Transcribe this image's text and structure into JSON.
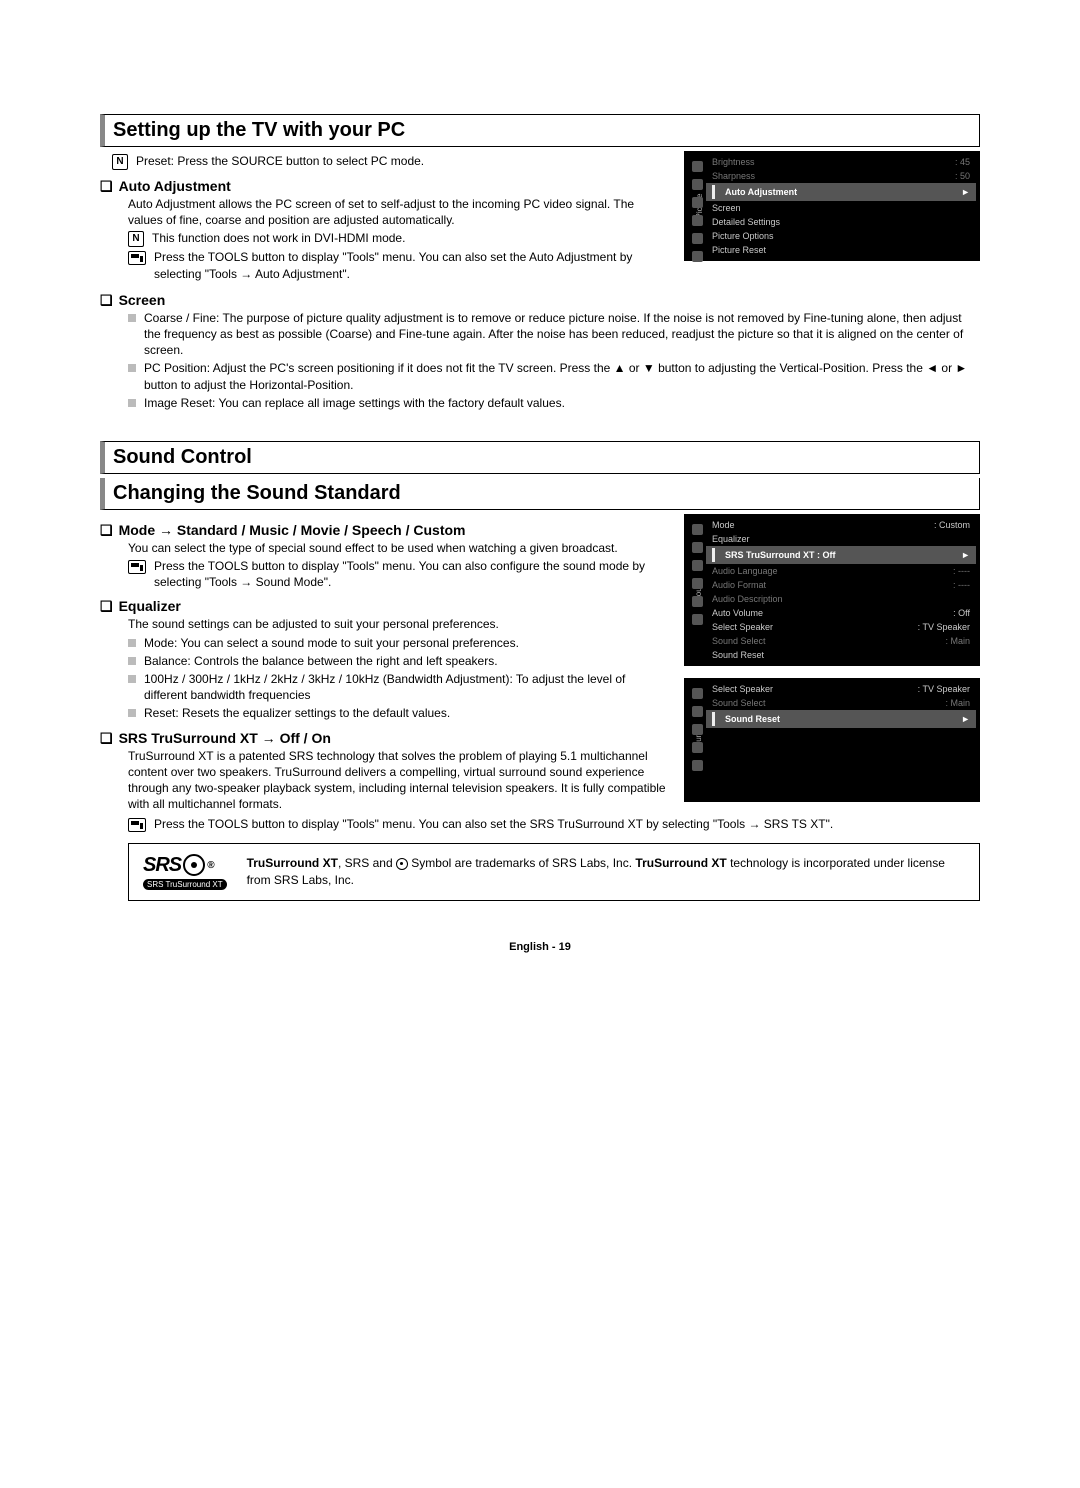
{
  "sections": {
    "pc": {
      "title": "Setting up the TV with your PC",
      "preset_note": "Preset: Press the SOURCE button to select PC mode.",
      "auto_adj": {
        "heading": "Auto Adjustment",
        "body": "Auto Adjustment allows the PC screen of set to self-adjust to the incoming PC video signal. The values of fine, coarse and position are adjusted automatically.",
        "note": "This function does not work in DVI-HDMI mode.",
        "tool": "Press the TOOLS button to display \"Tools\" menu. You can also set the Auto Adjustment by selecting \"Tools → Auto Adjustment\"."
      },
      "screen": {
        "heading": "Screen",
        "items": [
          "Coarse / Fine: The purpose of picture quality adjustment is to remove or reduce picture noise. If the noise is not removed by Fine-tuning alone, then adjust the frequency as best as possible (Coarse) and Fine-tune again. After the noise has been reduced, readjust the picture so that it is aligned on the center of screen.",
          "PC Position: Adjust the PC's screen positioning if it does not fit the TV screen. Press the ▲ or ▼ button to adjusting the Vertical-Position. Press the ◄ or ► button to adjust the Horizontal-Position.",
          "Image Reset: You can replace all image settings with the factory default values."
        ]
      }
    },
    "sound": {
      "title_major": "Sound Control",
      "title": "Changing the Sound Standard",
      "mode": {
        "heading": "Mode → Standard / Music / Movie / Speech / Custom",
        "body": "You can select the type of special sound effect to be used when watching a given broadcast.",
        "tool": "Press the TOOLS button to display \"Tools\" menu. You can also configure the sound mode by selecting \"Tools → Sound Mode\"."
      },
      "eq": {
        "heading": "Equalizer",
        "body": "The sound settings can be adjusted to suit your personal preferences.",
        "items": [
          "Mode: You can select a sound mode to suit your personal preferences.",
          "Balance: Controls the balance between the right and left speakers.",
          "100Hz / 300Hz / 1kHz / 2kHz / 3kHz / 10kHz (Bandwidth Adjustment): To adjust the level of different bandwidth frequencies",
          "Reset: Resets the equalizer settings to the default values."
        ]
      },
      "srs": {
        "heading": "SRS TruSurround XT → Off / On",
        "body": "TruSurround XT is a patented SRS technology that solves the problem of playing 5.1 multichannel content over two speakers. TruSurround delivers a compelling, virtual surround sound experience through any two-speaker playback system, including internal television speakers. It is fully compatible with all multichannel formats.",
        "tool": "Press the TOOLS button to display \"Tools\" menu. You can also set the SRS TruSurround XT by selecting \"Tools → SRS TS XT\"."
      },
      "srs_box": {
        "logo_text": "SRS",
        "logo_tag": "SRS TruSurround XT",
        "text_before": "TruSurround XT",
        "text_mid": ", SRS and ",
        "text_after": " Symbol are trademarks of SRS Labs, Inc. ",
        "text_bold2": "TruSurround XT",
        "text_rest": " technology is incorporated under license from SRS Labs, Inc."
      }
    }
  },
  "osd": {
    "picture": {
      "vlabel": "Picture",
      "rows": [
        {
          "k": "Brightness",
          "v": ": 45",
          "dim": true
        },
        {
          "k": "Sharpness",
          "v": ": 50",
          "dim": true
        },
        {
          "k": "Auto Adjustment",
          "v": "",
          "sel": true,
          "chev": "►"
        },
        {
          "k": "Screen",
          "v": ""
        },
        {
          "k": "Detailed Settings",
          "v": ""
        },
        {
          "k": "Picture Options",
          "v": ""
        },
        {
          "k": "Picture Reset",
          "v": ""
        }
      ]
    },
    "sound1": {
      "vlabel": "Sound",
      "rows": [
        {
          "k": "Mode",
          "v": ": Custom"
        },
        {
          "k": "Equalizer",
          "v": ""
        },
        {
          "k": "SRS TruSurround XT  : Off",
          "v": "",
          "sel": true,
          "chev": "►"
        },
        {
          "k": "Audio Language",
          "v": ": ----",
          "dim": true
        },
        {
          "k": "Audio Format",
          "v": ": ----",
          "dim": true
        },
        {
          "k": "Audio Description",
          "v": "",
          "dim": true
        },
        {
          "k": "Auto Volume",
          "v": ": Off"
        },
        {
          "k": "Select Speaker",
          "v": ": TV Speaker"
        },
        {
          "k": "Sound Select",
          "v": ": Main",
          "dim": true
        },
        {
          "k": "Sound Reset",
          "v": ""
        }
      ]
    },
    "sound2": {
      "vlabel": "Sound",
      "rows": [
        {
          "k": "Select Speaker",
          "v": ": TV Speaker"
        },
        {
          "k": "Sound Select",
          "v": ": Main",
          "dim": true
        },
        {
          "k": "Sound Reset",
          "v": "",
          "sel": true,
          "chev": "►"
        }
      ],
      "blanks": 5
    }
  },
  "footer": "English - 19"
}
